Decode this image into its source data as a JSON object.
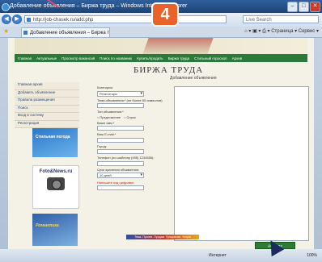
{
  "browser": {
    "title": "Добавление объявления – Биржа труда – Windows Internet Explorer",
    "address": "http://job-chasek.ru/add.php",
    "search_placeholder": "Live Search",
    "tab_label": "Добавление объявления – Биржа труда",
    "toolbar_icons": "⌂ ▾ ▣ ▾ ⎙ ▾ Страница ▾ Сервис ▾"
  },
  "step_number": "4",
  "site": {
    "title": "БИРЖА ТРУДА",
    "section_title": "Добавление объявления",
    "nav": [
      "Главная",
      "Актуальные",
      "Просмотр вакансий",
      "Поиск по названию",
      "Купить/продать",
      "Биржа труда",
      "Стильный гороскоп",
      "Архив"
    ],
    "sidebar": [
      "Главная архив",
      "Добавить объявление",
      "Правила размещения",
      "Поиск",
      "Вход в систему",
      "Регистрация"
    ],
    "ads": {
      "ad1": "Стильная погода",
      "ad2": "Foto&News.ru",
      "ad3": "Романтика"
    }
  },
  "form": {
    "category_label": "Категория:",
    "category_value": "Репетиторы",
    "subject_label": "Тема объявления:* (не более 60 символов)",
    "type_label": "Тип объявления:*",
    "type_options": [
      "Предложение",
      "Спрос"
    ],
    "name_label": "Ваше имя:*",
    "email_label": "Ваш E-mail:*",
    "city_label": "Город:",
    "phone_label": "Телефон (по шаблону (495) 1234556):",
    "period_label": "Срок хранения объявления:",
    "period_value": "10 дней",
    "captcha_label": "Напишите код цифрами:",
    "promo_text": "Тема. Прочее. Продам. Предлагаю. Услуги",
    "submit_label": "Добавить"
  },
  "status": {
    "zone": "Интернет",
    "zoom": "100%"
  }
}
